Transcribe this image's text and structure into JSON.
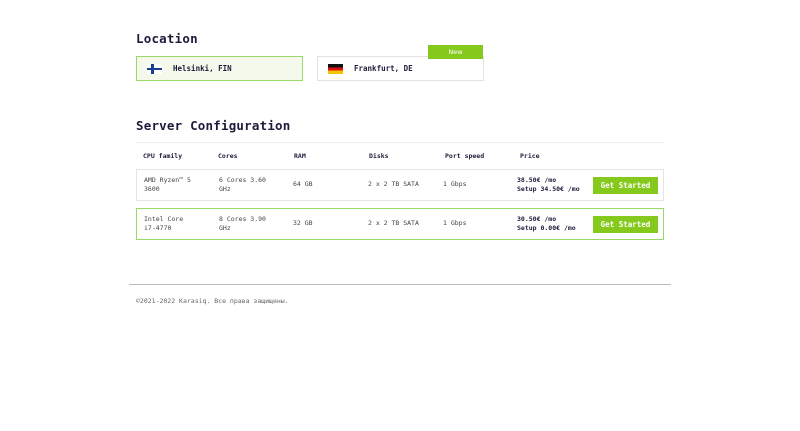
{
  "location": {
    "title": "Location",
    "cards": [
      {
        "name": "Helsinki, FIN",
        "flag": "finland-flag-icon",
        "selected": true
      },
      {
        "name": "Frankfurt, DE",
        "flag": "germany-flag-icon",
        "selected": false,
        "badge": "New"
      }
    ]
  },
  "server_config": {
    "title": "Server Configuration",
    "headers": [
      "CPU family",
      "Cores",
      "RAM",
      "Disks",
      "Port speed",
      "Price"
    ],
    "rows": [
      {
        "cpu_line1": "AMD Ryzen™ 5",
        "cpu_line2": "3600",
        "cores_line1": "6 Cores 3.60",
        "cores_line2": "GHz",
        "ram": "64 GB",
        "disks": "2 x 2 TB SATA",
        "port": "1 Gbps",
        "price": "38.50€ /mo",
        "setup": "Setup 34.50€ /mo",
        "button": "Get Started"
      },
      {
        "cpu_line1": "Intel Core",
        "cpu_line2": "i7-4770",
        "cores_line1": "8 Cores 3.90",
        "cores_line2": "GHz",
        "ram": "32 GB",
        "disks": "2 x 2 TB SATA",
        "port": "1 Gbps",
        "price": "30.50€ /mo",
        "setup": "Setup 0.00€ /mo",
        "button": "Get Started"
      }
    ]
  },
  "footer": {
    "text": "©2021-2022 Karasiq. Все права защищены."
  },
  "colors": {
    "accent": "#84c91c",
    "selected_border": "#9bd86a",
    "text": "#1c1c3a"
  }
}
